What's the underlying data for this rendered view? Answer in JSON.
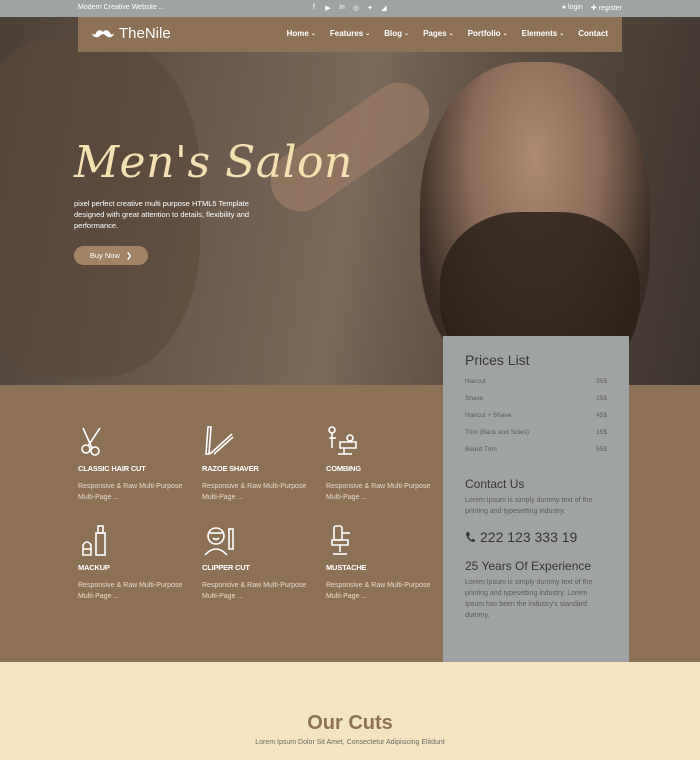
{
  "topbar": {
    "tagline": "Modern Creative Website ...",
    "social_icons": [
      "facebook-icon",
      "youtube-icon",
      "linkedin-icon",
      "dribbble-icon",
      "twitter-icon",
      "rss-icon"
    ],
    "login": "login",
    "register": "register"
  },
  "nav": {
    "logo": "TheNile",
    "items": [
      {
        "label": "Home",
        "caret": true
      },
      {
        "label": "Features",
        "caret": true
      },
      {
        "label": "Blog",
        "caret": true
      },
      {
        "label": "Pages",
        "caret": true
      },
      {
        "label": "Portfolio",
        "caret": true
      },
      {
        "label": "Elements",
        "caret": true
      },
      {
        "label": "Contact",
        "caret": false
      }
    ]
  },
  "hero": {
    "title": "Men's Salon",
    "description": "pixel perfect creative multi purpose HTML5 Template designed with great attention to details, flexibility and performance.",
    "button": "Buy Now"
  },
  "services": [
    {
      "icon": "scissors-icon",
      "title": "CLASSIC HAIR CUT",
      "desc": "Responsive & Raw Multi-Purpose Multi-Page ..."
    },
    {
      "icon": "razor-icon",
      "title": "RAZOE SHAVER",
      "desc": "Responsive & Raw Multi-Purpose Multi-Page ..."
    },
    {
      "icon": "barber-chair-icon",
      "title": "COMBING",
      "desc": "Responsive & Raw Multi-Purpose Multi-Page ..."
    },
    {
      "icon": "makeup-bottle-icon",
      "title": "MACKUP",
      "desc": "Responsive & Raw Multi-Purpose Multi-Page ..."
    },
    {
      "icon": "barber-icon",
      "title": "CLIPPER CUT",
      "desc": "Responsive & Raw Multi-Purpose Multi-Page ..."
    },
    {
      "icon": "chair-icon",
      "title": "MUSTACHE",
      "desc": "Responsive & Raw Multi-Purpose Multi-Page ..."
    }
  ],
  "prices": {
    "title": "Prices List",
    "items": [
      {
        "name": "Haircut",
        "price": "35$"
      },
      {
        "name": "Shave",
        "price": "25$"
      },
      {
        "name": "Haircut + Shave",
        "price": "45$"
      },
      {
        "name": "Trim (Back and Sides)",
        "price": "15$"
      },
      {
        "name": "Beard Trim",
        "price": "55$"
      }
    ],
    "contact_title": "Contact Us",
    "contact_text": "Lorem Ipsum is simply dummy text of the printing and typesetting industry.",
    "phone": "222 123 333 19",
    "experience_title": "25 Years Of Experience",
    "experience_text": "Lorem Ipsum is simply dummy text of the printing and typesetting industry. Lorem Ipsum has been the industry's standard dummy."
  },
  "cuts": {
    "title": "Our Cuts",
    "subtitle": "Lorem Ipsum Dolor Sit Amet, Consectetur Adipisicing Elitdunt"
  },
  "colors": {
    "brown": "#8d7155",
    "gray": "#a0a3a4",
    "cream": "#f4e5bf",
    "title_cream": "#f4e0b0"
  }
}
